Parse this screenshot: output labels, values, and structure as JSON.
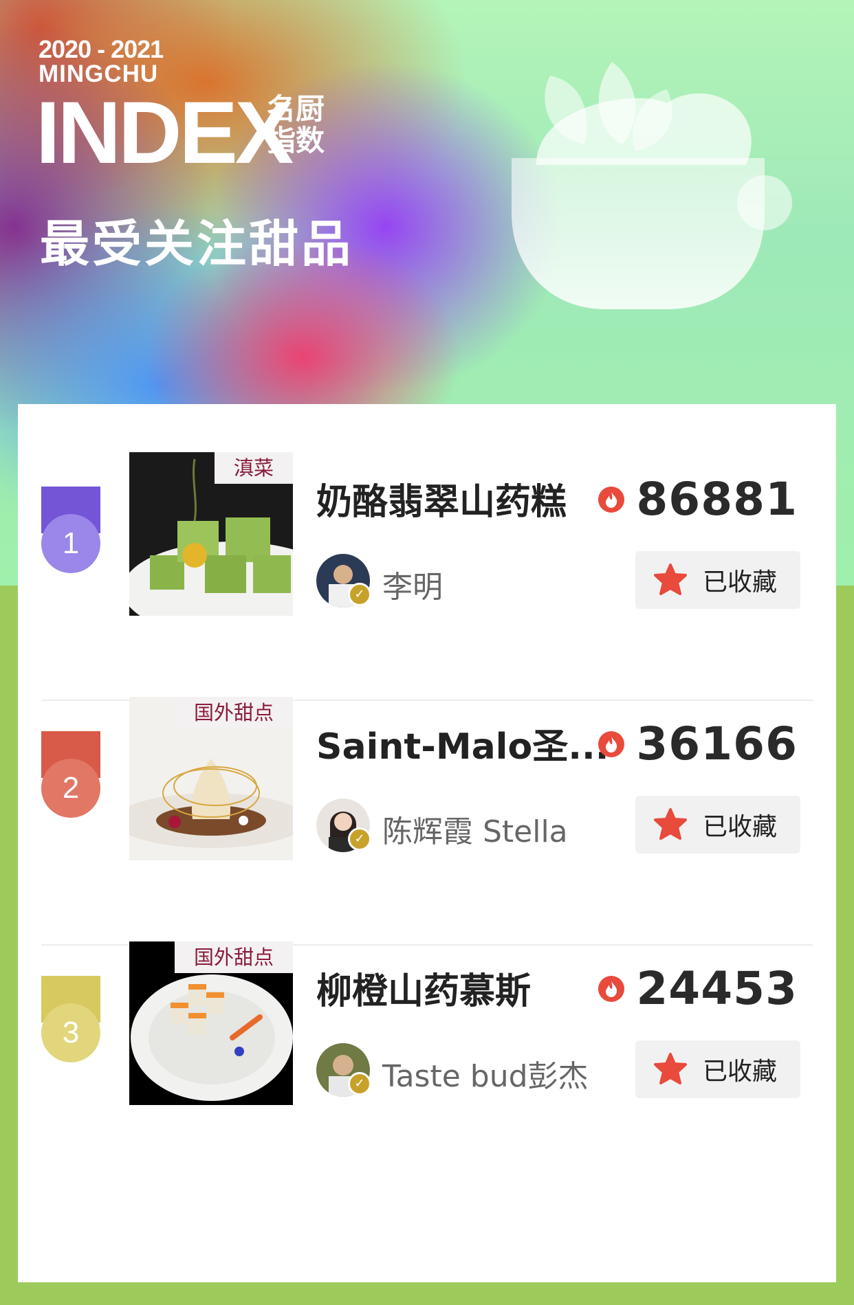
{
  "header": {
    "years": "2020 - 2021",
    "brand": "MINGCHU",
    "index_word": "INDEX",
    "brand_cn_1": "名厨",
    "brand_cn_2": "指数",
    "title": "最受关注甜品"
  },
  "colors": {
    "accent_red": "#e84a3c",
    "rank1": "#9b86ea",
    "rank2": "#e17764",
    "rank3": "#e2d67c",
    "tag_text": "#8a1c3c",
    "background_green": "#9ccb5c"
  },
  "favorite_label": "已收藏",
  "items": [
    {
      "rank": "1",
      "category": "滇菜",
      "name": "奶酪翡翠山药糕",
      "chef": "李明",
      "hot": "86881",
      "favorited": true,
      "icon": "fire-icon"
    },
    {
      "rank": "2",
      "category": "国外甜点",
      "name": "Saint-Malo圣...",
      "chef": "陈辉霞 Stella",
      "hot": "36166",
      "favorited": true,
      "icon": "fire-icon"
    },
    {
      "rank": "3",
      "category": "国外甜点",
      "name": "柳橙山药慕斯",
      "chef": "Taste bud彭杰",
      "hot": "24453",
      "favorited": true,
      "icon": "fire-icon"
    }
  ]
}
